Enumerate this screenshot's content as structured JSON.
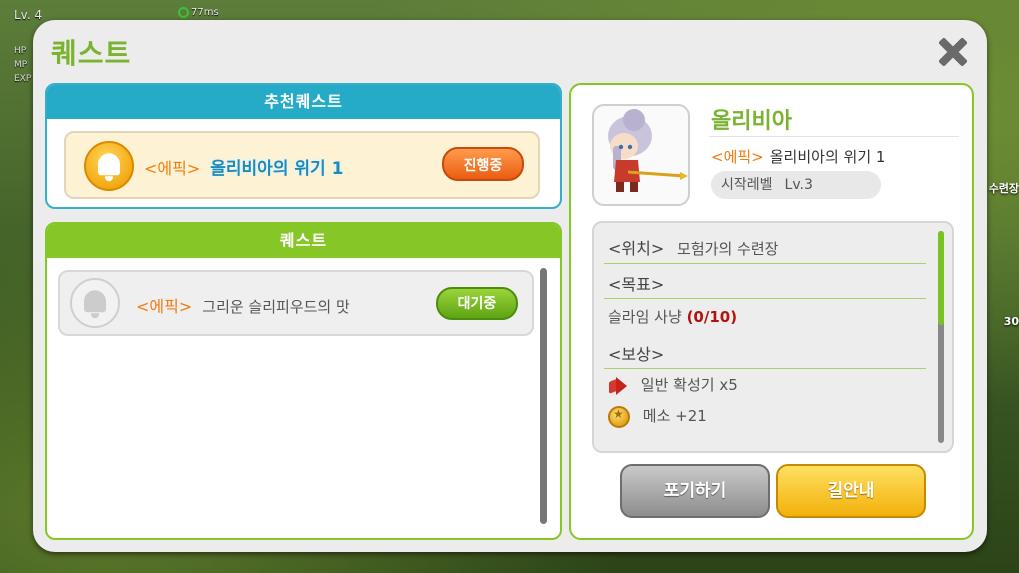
{
  "hud": {
    "level": "Lv. 4",
    "ping": "77ms",
    "hp_label": "HP",
    "mp_label": "MP",
    "exp_label": "EXP",
    "right_label": "수련장",
    "right_number": "30"
  },
  "dialog": {
    "title": "퀘스트",
    "close_icon": "close-icon"
  },
  "recommended": {
    "header": "추천퀘스트",
    "item": {
      "tag": "<에픽>",
      "name": "올리비아의 위기 1",
      "status_button": "진행중",
      "icon": "bell-icon"
    }
  },
  "quests": {
    "header": "퀘스트",
    "items": [
      {
        "tag": "<에픽>",
        "name": "그리운 슬리피우드의 맛",
        "status_button": "대기중",
        "icon": "bell-icon"
      }
    ]
  },
  "detail": {
    "npc_name": "올리비아",
    "quest_tag": "<에픽>",
    "quest_name": "올리비아의 위기 1",
    "level_label": "시작레벨",
    "level_value": "Lv.3",
    "location_head": "<위치>",
    "location_value": "모험가의 수련장",
    "goal_head": "<목표>",
    "goal_text": "슬라임 사냥",
    "goal_progress": "(0/10)",
    "reward_head": "<보상>",
    "rewards": [
      {
        "icon": "megaphone-icon",
        "text": "일반 확성기 x5"
      },
      {
        "icon": "meso-coin-icon",
        "text": "메소 +21"
      }
    ],
    "giveup_button": "포기하기",
    "guide_button": "길안내"
  },
  "colors": {
    "title_green": "#79b330",
    "recommended_blue": "#25aac8",
    "quest_green": "#86c626",
    "epic_orange": "#f07e12",
    "progress_orange": "#ea5d12",
    "guide_yellow": "#f2b10c"
  }
}
